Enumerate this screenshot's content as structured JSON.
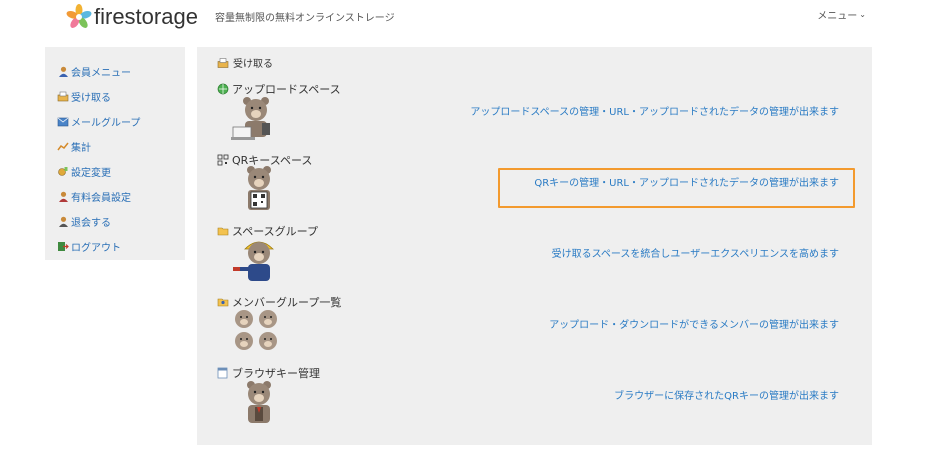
{
  "header": {
    "logo_text": "firestorage",
    "tagline": "容量無制限の無料オンラインストレージ",
    "menu_label": "メニュー"
  },
  "sidebar": {
    "items": [
      {
        "label": "会員メニュー",
        "icon": "member-icon"
      },
      {
        "label": "受け取る",
        "icon": "inbox-icon"
      },
      {
        "label": "メールグループ",
        "icon": "mail-group-icon"
      },
      {
        "label": "集計",
        "icon": "stats-icon"
      },
      {
        "label": "設定変更",
        "icon": "settings-icon"
      },
      {
        "label": "有料会員設定",
        "icon": "paid-member-icon"
      },
      {
        "label": "退会する",
        "icon": "withdraw-icon"
      },
      {
        "label": "ログアウト",
        "icon": "logout-icon"
      }
    ]
  },
  "main": {
    "heading": "受け取る",
    "sections": [
      {
        "title": "アップロードスペース",
        "link": "アップロードスペースの管理・URL・アップロードされたデータの管理が出来ます",
        "icon": "globe-icon"
      },
      {
        "title": "QRキースペース",
        "link": "QRキーの管理・URL・アップロードされたデータの管理が出来ます",
        "icon": "qr-icon"
      },
      {
        "title": "スペースグループ",
        "link": "受け取るスペースを統合しユーザーエクスペリエンスを高めます",
        "icon": "folder-icon"
      },
      {
        "title": "メンバーグループ一覧",
        "link": "アップロード・ダウンロードができるメンバーの管理が出来ます",
        "icon": "member-group-icon"
      },
      {
        "title": "ブラウザキー管理",
        "link": "ブラウザーに保存されたQRキーの管理が出来ます",
        "icon": "browser-key-icon"
      }
    ]
  },
  "colors": {
    "link": "#2a7bc4",
    "panel_bg": "#efefef",
    "highlight": "#f39a2e"
  }
}
